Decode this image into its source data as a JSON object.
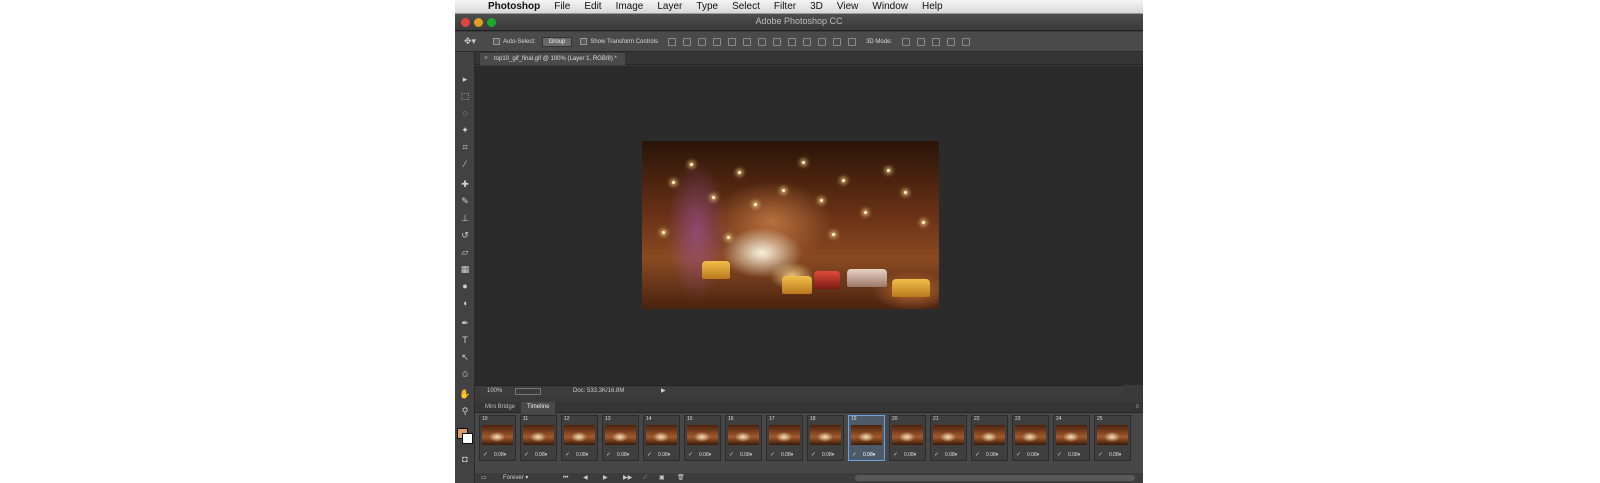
{
  "menubar": {
    "apple": "",
    "items": [
      "Photoshop",
      "File",
      "Edit",
      "Image",
      "Layer",
      "Type",
      "Select",
      "Filter",
      "3D",
      "View",
      "Window",
      "Help"
    ]
  },
  "window": {
    "title": "Adobe Photoshop CC"
  },
  "options": {
    "auto_select_label": "Auto-Select:",
    "auto_select_value": "Group",
    "transform_label": "Show Transform Controls",
    "mode_label": "3D Mode:"
  },
  "document": {
    "tab_label": "top10_gif_final.gif @ 100% (Layer 1, RGB/8) *"
  },
  "status": {
    "zoom": "100%",
    "doc_size": "Doc: 533.3K/16.8M"
  },
  "panels": {
    "tabs": [
      "Mini Bridge",
      "Timeline"
    ]
  },
  "timeline": {
    "frames": [
      {
        "num": "10",
        "delay": "0.08▾"
      },
      {
        "num": "11",
        "delay": "0.08▾"
      },
      {
        "num": "12",
        "delay": "0.08▾"
      },
      {
        "num": "13",
        "delay": "0.08▾"
      },
      {
        "num": "14",
        "delay": "0.08▾"
      },
      {
        "num": "15",
        "delay": "0.08▾"
      },
      {
        "num": "16",
        "delay": "0.08▾"
      },
      {
        "num": "17",
        "delay": "0.08▾"
      },
      {
        "num": "18",
        "delay": "0.08▾"
      },
      {
        "num": "19",
        "delay": "0.08▾"
      },
      {
        "num": "20",
        "delay": "0.08▾"
      },
      {
        "num": "21",
        "delay": "0.08▾"
      },
      {
        "num": "22",
        "delay": "0.08▾"
      },
      {
        "num": "23",
        "delay": "0.08▾"
      },
      {
        "num": "24",
        "delay": "0.08▾"
      },
      {
        "num": "25",
        "delay": "0.08▾"
      }
    ],
    "selected_index": 9,
    "loop": "Forever"
  },
  "colors": {
    "foreground": "#d99b6b",
    "background": "#ffffff",
    "selection": "#6aa3e0"
  }
}
